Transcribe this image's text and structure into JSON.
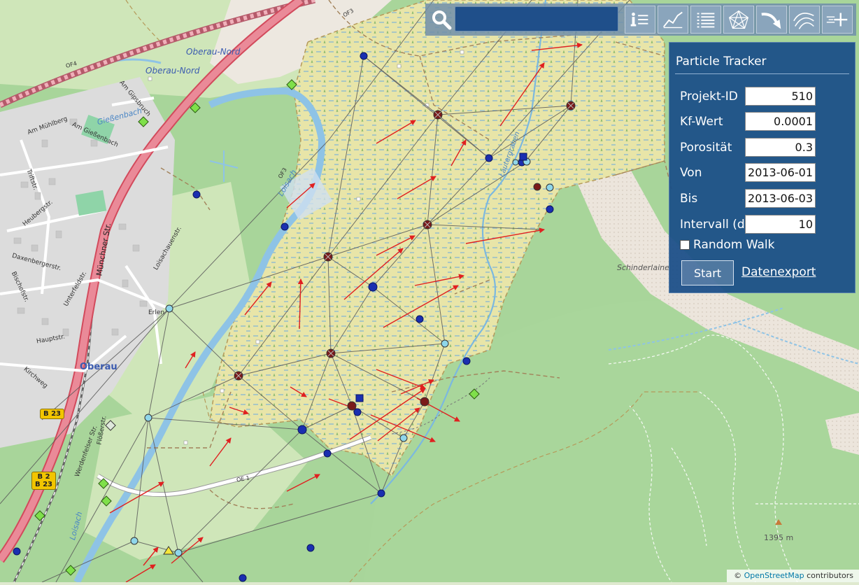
{
  "map": {
    "labels": {
      "oberau_nord_1": "Oberau-Nord",
      "oberau_nord_2": "Oberau-Nord",
      "oberau": "Oberau",
      "am_gipsbruch": "Am Gipsbruch",
      "giessenbach_river": "Gießenbach",
      "am_giessenbach": "Am Gießenbach",
      "am_muehlberg": "Am Mühlberg",
      "triftstr": "Triftstr.",
      "heubergstr": "Heubergstr.",
      "daxenbergerstr": "Daxenbergerstr.",
      "bischofstr": "Bischofstr.",
      "unterfeldstr": "Unterfeldstr.",
      "loisachauenstr": "Loisachauenstr.",
      "munchner_str": "Münchner Str.",
      "hauptstr": "Hauptstr.",
      "kirchweg": "Kirchweg",
      "floesserstr": "Flößerstr.",
      "werdenfelser_str": "Werdenfelser Str.",
      "erlen": "Erlen",
      "loisach_1": "Loisach",
      "loisach_2": "Loisach",
      "of3_1": "OF3",
      "of3_2": "OF3",
      "of4": "OF4",
      "oe1": "OE 1",
      "lautergraben": "Lautergraben",
      "schinderlaine": "Schinderlaine",
      "peak_elevation": "1395 m",
      "sign_b23": "B 23",
      "sign_b2_line1": "B 2",
      "sign_b2_line2": "B 23"
    }
  },
  "toolbar": {
    "search_icon": "search-icon",
    "search_value": "",
    "buttons": [
      {
        "name": "info-list-button",
        "icon": "info-list-icon"
      },
      {
        "name": "line-chart-button",
        "icon": "line-chart-icon"
      },
      {
        "name": "list-button",
        "icon": "list-icon"
      },
      {
        "name": "mesh-button",
        "icon": "triangle-mesh-icon"
      },
      {
        "name": "flow-arrow-button",
        "icon": "curved-arrow-icon"
      },
      {
        "name": "streamlines-button",
        "icon": "streamlines-icon"
      },
      {
        "name": "add-particle-button",
        "icon": "particle-add-icon"
      }
    ]
  },
  "panel": {
    "title": "Particle Tracker",
    "fields": {
      "projekt_id": {
        "label": "Projekt-ID",
        "value": "510"
      },
      "kf_wert": {
        "label": "Kf-Wert",
        "value": "0.0001"
      },
      "porositaet": {
        "label": "Porosität",
        "value": "0.3"
      },
      "von": {
        "label": "Von",
        "value": "2013-06-01"
      },
      "bis": {
        "label": "Bis",
        "value": "2013-06-03"
      },
      "intervall": {
        "label": "Intervall (d)",
        "value": "10"
      }
    },
    "random_walk_label": "Random Walk",
    "random_walk_checked": false,
    "start_label": "Start",
    "export_label": "Datenexport"
  },
  "attribution": {
    "copyright": "©",
    "link_text": "OpenStreetMap",
    "suffix": "contributors"
  },
  "colors": {
    "panel_bg": "#194d88",
    "toolbar_bg": "#708eaa",
    "flow_arrow": "#e02020",
    "wetland": "#e9e6a6",
    "forest": "#a9d79a",
    "water": "#7bb8e0",
    "mesh_line": "#555555",
    "main_road": "#e06a7a"
  }
}
